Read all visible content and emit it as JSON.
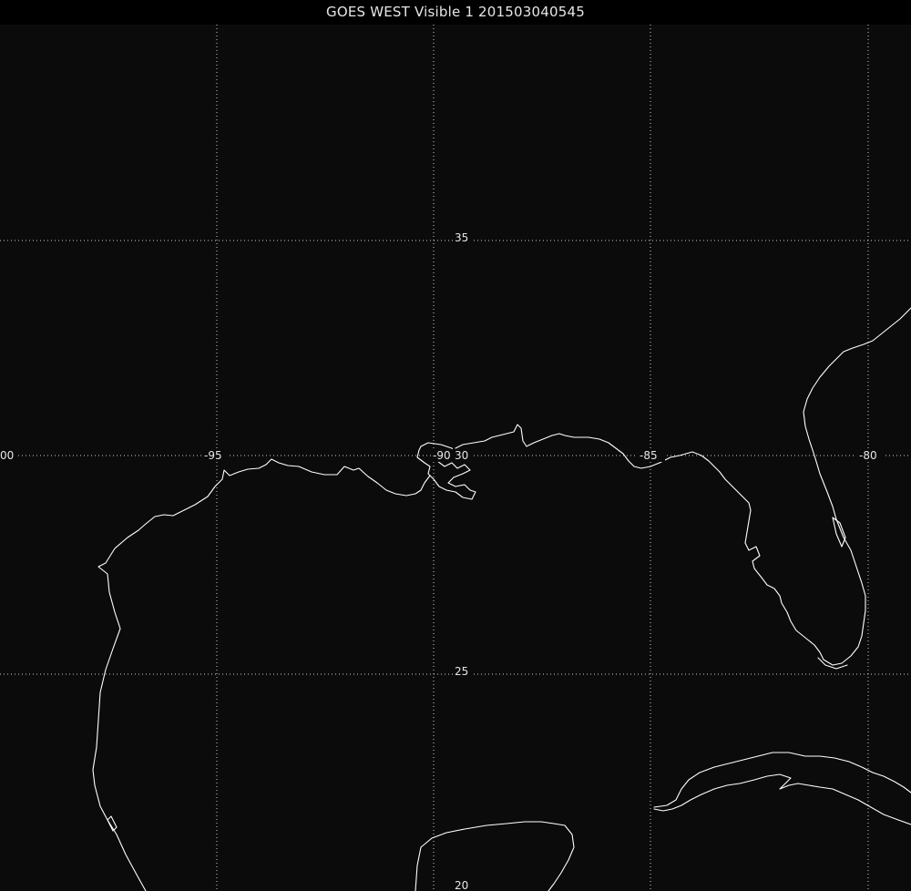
{
  "title": "GOES WEST Visible 1 201503040545",
  "grid": {
    "longitude_labels": [
      "00",
      "-95",
      "-90",
      "-85",
      "-80"
    ],
    "latitude_labels": [
      "35",
      "30",
      "25",
      "20"
    ]
  },
  "colors": {
    "background": "#0b0b0b",
    "coastline": "#ffffff",
    "grid": "#cfcfcf"
  }
}
